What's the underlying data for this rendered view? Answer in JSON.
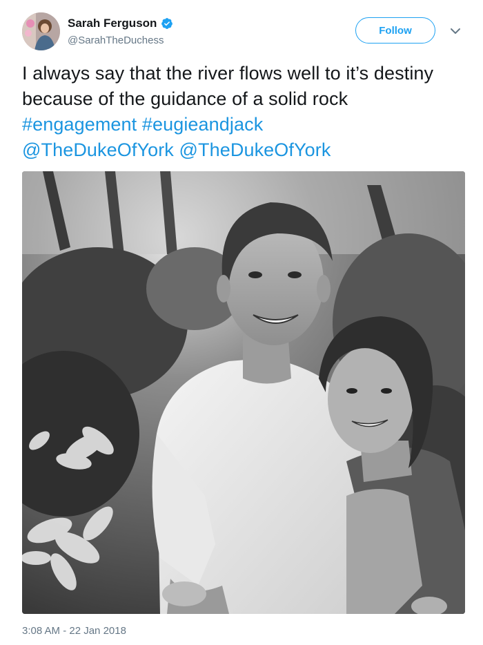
{
  "author": {
    "display_name": "Sarah Ferguson",
    "handle": "@SarahTheDuchess",
    "verified_icon": "verified-badge-icon",
    "avatar_icon": "avatar"
  },
  "actions": {
    "follow_label": "Follow",
    "menu_icon": "chevron-down-icon"
  },
  "tweet": {
    "text_plain": "I always say that the river flows well to it’s destiny because of the guidance of a solid rock",
    "hashtags": [
      "#engagement",
      "#eugieandjack"
    ],
    "mentions": [
      "@TheDukeOfYork",
      "@TheDukeOfYork"
    ],
    "timestamp": "3:08 AM - 22 Jan 2018"
  },
  "photo": {
    "style": "black-and-white"
  },
  "colors": {
    "link": "#1b95e0",
    "accent": "#1da1f2",
    "muted": "#657786",
    "text": "#14171a"
  }
}
